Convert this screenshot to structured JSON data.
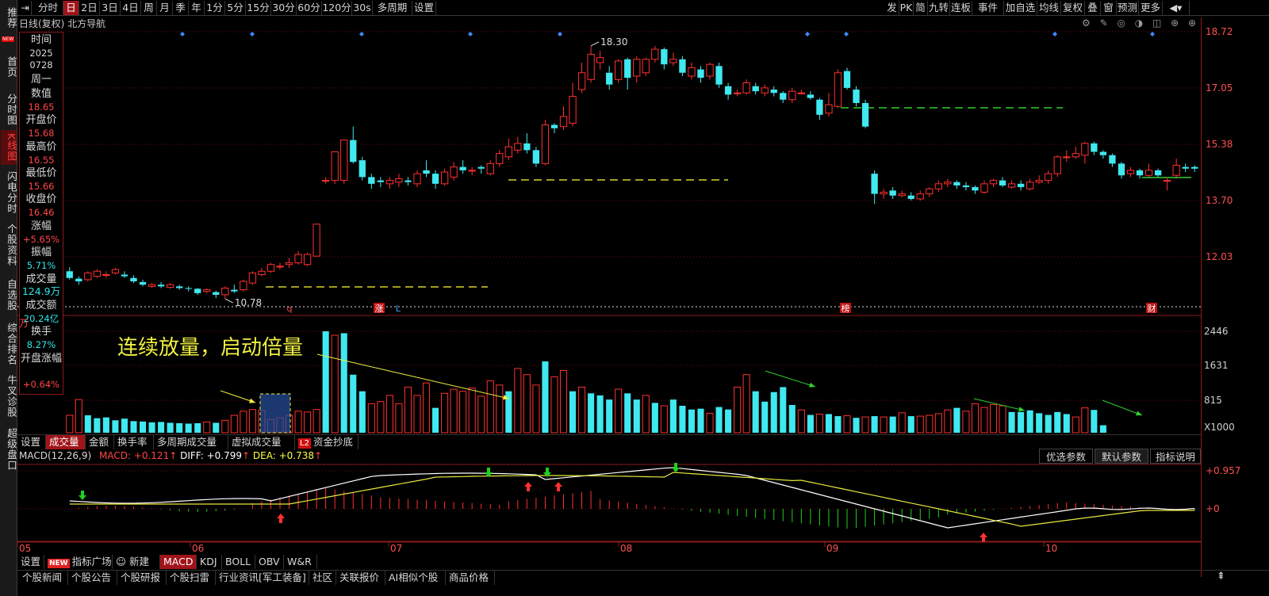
{
  "sidebar": [
    {
      "label": "推荐"
    },
    {
      "label": "首页"
    },
    {
      "label": "分时图"
    },
    {
      "label": "K线图",
      "selected": true
    },
    {
      "label": "闪电分时"
    },
    {
      "label": "个股资料"
    },
    {
      "label": "自选股"
    },
    {
      "label": "综合排名"
    },
    {
      "label": "牛叉诊股"
    },
    {
      "label": "超级盘口"
    }
  ],
  "sidebar_new_tag": "NEW",
  "toolbar_left": [
    "分时",
    "日",
    "2日",
    "3日",
    "4日",
    "周",
    "月",
    "季",
    "年",
    "1分",
    "5分",
    "15分",
    "30分",
    "60分",
    "120分",
    "30s",
    "多周期",
    "设置"
  ],
  "toolbar_right": [
    "发",
    "PK",
    "简",
    "九转",
    "连板",
    "事件",
    "加自选",
    "均线",
    "复权",
    "叠",
    "窗",
    "预测",
    "更多"
  ],
  "title": "日线(复权)  北方导航",
  "info": {
    "time_label": "时间",
    "year": "2025",
    "date": "0728",
    "weekday": "周一",
    "value_label": "数值",
    "value": "18.65",
    "open_label": "开盘价",
    "open": "15.68",
    "high_label": "最高价",
    "high": "16.55",
    "low_label": "最低价",
    "low": "15.66",
    "close_label": "收盘价",
    "close": "16.46",
    "chg_label": "涨幅",
    "chg": "+5.65%",
    "amp_label": "振幅",
    "amp": "5.71%",
    "vol_label": "成交量",
    "vol": "124.9万",
    "amt_label": "成交额",
    "amt": "20.24亿",
    "turn_label": "换手",
    "turn": "8.27%",
    "openchg_label": "开盘涨幅",
    "openchg": "+0.64%"
  },
  "price_axis": [
    "18.72",
    "17.05",
    "15.38",
    "13.70",
    "12.03"
  ],
  "volume_axis": [
    "2446",
    "1631",
    "815",
    "X1000"
  ],
  "macd_axis": [
    "+0.957",
    "+0"
  ],
  "marks": {
    "high": "18.30",
    "low": "10.78"
  },
  "event_tags": [
    "q",
    "涨",
    "L",
    "榜",
    "财"
  ],
  "volume_unit": "万",
  "annotation": "连续放量，启动倍量",
  "volume_tabs": [
    "设置",
    "成交量",
    "金额",
    "换手率",
    "多周期成交量",
    "虚拟成交量",
    "资金抄底"
  ],
  "l2": "L2",
  "macd_info": {
    "name": "MACD(12,26,9)",
    "macd": "MACD: +0.121",
    "diff": "DIFF: +0.799",
    "dea": "DEA: +0.738"
  },
  "param_buttons": [
    "优选参数",
    "默认参数",
    "指标说明"
  ],
  "months": [
    "05",
    "06",
    "07",
    "08",
    "09",
    "10"
  ],
  "indicator_tabs": [
    "设置",
    "指标广场",
    "新建",
    "MACD",
    "KDJ",
    "BOLL",
    "OBV",
    "W&R"
  ],
  "new_badge": "NEW",
  "bottom_tabs": [
    "个股新闻",
    "个股公告",
    "个股研报",
    "个股扫雷",
    "行业资讯[军工装备]",
    "社区",
    "关联报价",
    "AI相似个股",
    "商品价格"
  ],
  "colors": {
    "up": "#ff3030",
    "down": "#40e8f0",
    "bg": "#000000",
    "accent": "#a0141a",
    "dash": "#d8d030",
    "green_dash": "#30d030"
  },
  "chart_data": {
    "type": "candlestick",
    "title": "北方导航",
    "ylim": [
      10.5,
      18.9
    ],
    "candles": [
      [
        11.6,
        11.4,
        11.72,
        11.35
      ],
      [
        11.38,
        11.3,
        11.45,
        11.2
      ],
      [
        11.35,
        11.55,
        11.6,
        11.3
      ],
      [
        11.45,
        11.6,
        11.66,
        11.4
      ],
      [
        11.5,
        11.5,
        11.6,
        11.4
      ],
      [
        11.55,
        11.65,
        11.7,
        11.5
      ],
      [
        11.5,
        11.45,
        11.6,
        11.4
      ],
      [
        11.4,
        11.3,
        11.48,
        11.25
      ],
      [
        11.28,
        11.2,
        11.35,
        11.15
      ],
      [
        11.15,
        11.2,
        11.25,
        11.1
      ],
      [
        11.2,
        11.15,
        11.28,
        11.1
      ],
      [
        11.12,
        11.2,
        11.25,
        11.08
      ],
      [
        11.15,
        11.1,
        11.2,
        11.05
      ],
      [
        11.1,
        11.08,
        11.15,
        11.0
      ],
      [
        11.08,
        10.95,
        11.1,
        10.9
      ],
      [
        11.0,
        11.05,
        11.1,
        10.95
      ],
      [
        10.98,
        10.9,
        11.02,
        10.8
      ],
      [
        10.9,
        11.1,
        11.15,
        10.78
      ],
      [
        11.05,
        11.0,
        11.2,
        10.95
      ],
      [
        11.05,
        11.3,
        11.35,
        11.0
      ],
      [
        11.25,
        11.55,
        11.6,
        11.2
      ],
      [
        11.5,
        11.6,
        11.7,
        11.45
      ],
      [
        11.6,
        11.8,
        11.85,
        11.55
      ],
      [
        11.75,
        11.75,
        11.85,
        11.65
      ],
      [
        11.8,
        11.85,
        12.0,
        11.7
      ],
      [
        11.85,
        12.1,
        12.2,
        11.8
      ],
      [
        11.8,
        12.1,
        12.15,
        11.75
      ],
      [
        12.05,
        13.0,
        13.0,
        12.05
      ],
      [
        14.3,
        14.3,
        14.4,
        14.2
      ],
      [
        14.3,
        15.15,
        15.15,
        14.2
      ],
      [
        14.3,
        15.5,
        15.5,
        14.2
      ],
      [
        15.5,
        14.85,
        15.9,
        14.8
      ],
      [
        14.9,
        14.4,
        15.0,
        14.3
      ],
      [
        14.4,
        14.2,
        14.5,
        14.05
      ],
      [
        14.3,
        14.25,
        14.4,
        14.1
      ],
      [
        14.2,
        14.3,
        14.4,
        14.05
      ],
      [
        14.25,
        14.35,
        14.5,
        14.1
      ],
      [
        14.3,
        14.25,
        14.4,
        14.15
      ],
      [
        14.2,
        14.5,
        14.6,
        14.1
      ],
      [
        14.6,
        14.5,
        14.9,
        14.4
      ],
      [
        14.5,
        14.2,
        14.6,
        14.05
      ],
      [
        14.2,
        14.55,
        14.65,
        14.15
      ],
      [
        14.4,
        14.7,
        14.85,
        14.3
      ],
      [
        14.7,
        14.6,
        14.9,
        14.5
      ],
      [
        14.6,
        14.6,
        14.7,
        14.45
      ],
      [
        14.7,
        14.65,
        14.75,
        14.5
      ],
      [
        14.5,
        14.8,
        14.9,
        14.45
      ],
      [
        14.8,
        15.1,
        15.2,
        14.7
      ],
      [
        15.0,
        15.3,
        15.55,
        14.9
      ],
      [
        15.2,
        15.4,
        15.6,
        15.1
      ],
      [
        15.4,
        15.2,
        15.7,
        15.1
      ],
      [
        15.2,
        14.8,
        15.3,
        14.7
      ],
      [
        14.8,
        15.95,
        16.1,
        14.75
      ],
      [
        15.95,
        15.85,
        16.0,
        15.7
      ],
      [
        15.9,
        16.2,
        16.5,
        15.8
      ],
      [
        16.0,
        16.8,
        17.2,
        15.9
      ],
      [
        17.0,
        17.5,
        17.8,
        16.9
      ],
      [
        17.3,
        18.05,
        18.3,
        17.2
      ],
      [
        17.8,
        17.95,
        18.15,
        17.6
      ],
      [
        17.5,
        17.15,
        17.7,
        17.0
      ],
      [
        17.3,
        17.85,
        17.9,
        17.2
      ],
      [
        17.9,
        17.35,
        17.95,
        17.0
      ],
      [
        17.4,
        17.9,
        18.0,
        17.2
      ],
      [
        17.5,
        17.9,
        17.95,
        17.4
      ],
      [
        17.9,
        18.2,
        18.3,
        17.8
      ],
      [
        18.2,
        17.75,
        18.25,
        17.6
      ],
      [
        17.8,
        17.9,
        18.1,
        17.7
      ],
      [
        17.9,
        17.5,
        18.0,
        17.4
      ],
      [
        17.4,
        17.65,
        17.8,
        17.3
      ],
      [
        17.6,
        17.35,
        17.7,
        17.2
      ],
      [
        17.4,
        17.75,
        17.8,
        17.3
      ],
      [
        17.7,
        17.15,
        17.8,
        17.05
      ],
      [
        17.1,
        16.85,
        17.2,
        16.7
      ],
      [
        16.9,
        16.9,
        17.0,
        16.8
      ],
      [
        16.9,
        17.2,
        17.3,
        16.85
      ],
      [
        17.1,
        16.95,
        17.2,
        16.85
      ],
      [
        16.9,
        17.05,
        17.15,
        16.8
      ],
      [
        17.0,
        16.9,
        17.1,
        16.8
      ],
      [
        16.9,
        16.7,
        16.95,
        16.6
      ],
      [
        16.7,
        16.95,
        17.05,
        16.6
      ],
      [
        16.9,
        16.9,
        17.0,
        16.85
      ],
      [
        16.85,
        16.75,
        16.95,
        16.7
      ],
      [
        16.7,
        16.25,
        16.75,
        16.1
      ],
      [
        16.3,
        16.55,
        16.9,
        16.2
      ],
      [
        16.5,
        17.5,
        17.6,
        16.45
      ],
      [
        17.55,
        17.05,
        17.65,
        17.0
      ],
      [
        17.0,
        16.6,
        17.1,
        16.5
      ],
      [
        16.6,
        15.9,
        16.7,
        15.85
      ],
      [
        14.5,
        13.9,
        14.6,
        13.6
      ],
      [
        13.9,
        13.95,
        14.05,
        13.75
      ],
      [
        14.0,
        13.85,
        14.1,
        13.75
      ],
      [
        13.85,
        13.9,
        14.0,
        13.8
      ],
      [
        13.85,
        13.75,
        13.95,
        13.7
      ],
      [
        13.75,
        13.9,
        14.0,
        13.7
      ],
      [
        13.9,
        14.05,
        14.1,
        13.8
      ],
      [
        14.05,
        14.2,
        14.3,
        13.95
      ],
      [
        14.2,
        14.25,
        14.35,
        14.1
      ],
      [
        14.25,
        14.15,
        14.3,
        14.05
      ],
      [
        14.15,
        14.1,
        14.25,
        14.0
      ],
      [
        14.1,
        14.0,
        14.15,
        13.9
      ],
      [
        13.95,
        14.2,
        14.3,
        13.9
      ],
      [
        14.2,
        14.3,
        14.35,
        14.1
      ],
      [
        14.3,
        14.15,
        14.4,
        14.1
      ],
      [
        14.1,
        14.2,
        14.3,
        14.05
      ],
      [
        14.2,
        14.1,
        14.3,
        14.0
      ],
      [
        14.05,
        14.25,
        14.35,
        14.0
      ],
      [
        14.25,
        14.3,
        14.45,
        14.2
      ],
      [
        14.3,
        14.5,
        14.6,
        14.2
      ],
      [
        14.5,
        15.0,
        15.05,
        14.4
      ],
      [
        15.0,
        15.0,
        15.2,
        14.85
      ],
      [
        15.0,
        15.1,
        15.3,
        14.95
      ],
      [
        15.05,
        15.4,
        15.45,
        14.8
      ],
      [
        15.4,
        15.15,
        15.45,
        15.05
      ],
      [
        15.15,
        15.05,
        15.2,
        14.95
      ],
      [
        15.05,
        14.8,
        15.1,
        14.7
      ],
      [
        14.8,
        14.45,
        14.85,
        14.35
      ],
      [
        14.5,
        14.6,
        14.7,
        14.4
      ],
      [
        14.6,
        14.45,
        14.65,
        14.35
      ],
      [
        14.45,
        14.6,
        14.8,
        14.4
      ],
      [
        14.6,
        14.45,
        14.65,
        14.4
      ],
      [
        14.3,
        14.3,
        14.4,
        14.0
      ],
      [
        14.45,
        14.75,
        14.95,
        14.35
      ],
      [
        14.7,
        14.65,
        14.8,
        14.55
      ],
      [
        14.7,
        14.65,
        14.75,
        14.55
      ]
    ],
    "volumes": [
      [
        420,
        1
      ],
      [
        800,
        1
      ],
      [
        420,
        0
      ],
      [
        350,
        0
      ],
      [
        370,
        0
      ],
      [
        300,
        0
      ],
      [
        340,
        0
      ],
      [
        280,
        0
      ],
      [
        270,
        0
      ],
      [
        250,
        0
      ],
      [
        260,
        0
      ],
      [
        240,
        0
      ],
      [
        230,
        0
      ],
      [
        220,
        0
      ],
      [
        230,
        0
      ],
      [
        260,
        1
      ],
      [
        240,
        0
      ],
      [
        300,
        1
      ],
      [
        420,
        1
      ],
      [
        520,
        1
      ],
      [
        560,
        1
      ],
      [
        540,
        1
      ],
      [
        320,
        1
      ],
      [
        360,
        1
      ],
      [
        420,
        1
      ],
      [
        520,
        1
      ],
      [
        500,
        1
      ],
      [
        560,
        1
      ],
      [
        2446,
        0
      ],
      [
        2350,
        1
      ],
      [
        2400,
        0
      ],
      [
        1400,
        0
      ],
      [
        1000,
        0
      ],
      [
        700,
        1
      ],
      [
        750,
        1
      ],
      [
        900,
        1
      ],
      [
        700,
        1
      ],
      [
        1100,
        1
      ],
      [
        900,
        1
      ],
      [
        1200,
        1
      ],
      [
        600,
        0
      ],
      [
        950,
        1
      ],
      [
        1050,
        1
      ],
      [
        1000,
        1
      ],
      [
        1080,
        1
      ],
      [
        880,
        1
      ],
      [
        1250,
        1
      ],
      [
        1150,
        1
      ],
      [
        1000,
        0
      ],
      [
        1550,
        1
      ],
      [
        1400,
        1
      ],
      [
        1150,
        1
      ],
      [
        1720,
        0
      ],
      [
        1350,
        1
      ],
      [
        1500,
        1
      ],
      [
        1000,
        0
      ],
      [
        1100,
        1
      ],
      [
        950,
        0
      ],
      [
        900,
        0
      ],
      [
        800,
        0
      ],
      [
        1050,
        1
      ],
      [
        950,
        0
      ],
      [
        800,
        0
      ],
      [
        900,
        1
      ],
      [
        720,
        0
      ],
      [
        650,
        1
      ],
      [
        800,
        0
      ],
      [
        650,
        0
      ],
      [
        560,
        0
      ],
      [
        580,
        0
      ],
      [
        470,
        1
      ],
      [
        620,
        0
      ],
      [
        560,
        0
      ],
      [
        1100,
        1
      ],
      [
        1400,
        1
      ],
      [
        1000,
        0
      ],
      [
        750,
        0
      ],
      [
        980,
        0
      ],
      [
        1100,
        0
      ],
      [
        670,
        0
      ],
      [
        550,
        1
      ],
      [
        430,
        0
      ],
      [
        450,
        1
      ],
      [
        450,
        0
      ],
      [
        400,
        0
      ],
      [
        410,
        1
      ],
      [
        360,
        0
      ],
      [
        380,
        1
      ],
      [
        400,
        0
      ],
      [
        380,
        1
      ],
      [
        390,
        0
      ],
      [
        480,
        1
      ],
      [
        400,
        0
      ],
      [
        400,
        1
      ],
      [
        420,
        1
      ],
      [
        460,
        1
      ],
      [
        550,
        1
      ],
      [
        600,
        0
      ],
      [
        520,
        1
      ],
      [
        700,
        1
      ],
      [
        610,
        1
      ],
      [
        680,
        1
      ],
      [
        650,
        1
      ],
      [
        500,
        0
      ],
      [
        500,
        0
      ],
      [
        540,
        0
      ],
      [
        470,
        0
      ],
      [
        430,
        0
      ],
      [
        500,
        0
      ],
      [
        450,
        0
      ],
      [
        380,
        1
      ],
      [
        600,
        1
      ],
      [
        550,
        0
      ],
      [
        180,
        0
      ]
    ],
    "macd_axis_label": "+0.957"
  }
}
